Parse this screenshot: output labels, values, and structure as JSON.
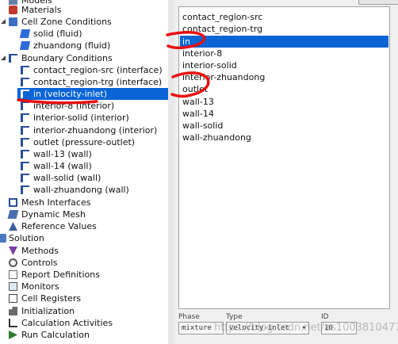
{
  "tree": {
    "items": [
      {
        "label": "Models",
        "icon": "models-icon"
      },
      {
        "label": "Materials",
        "icon": "materials-icon"
      },
      {
        "label": "Cell Zone Conditions",
        "icon": "cell-zone-icon"
      },
      {
        "label": "solid (fluid)",
        "icon": "zone-icon"
      },
      {
        "label": "zhuandong (fluid)",
        "icon": "zone-icon"
      },
      {
        "label": "Boundary Conditions",
        "icon": "boundary-icon"
      },
      {
        "label": "contact_region-src (interface)",
        "icon": "bc-icon"
      },
      {
        "label": "contact_region-trg (interface)",
        "icon": "bc-icon"
      },
      {
        "label": "in (velocity-inlet)",
        "icon": "bc-icon"
      },
      {
        "label": "interior-8 (interior)",
        "icon": "bc-icon"
      },
      {
        "label": "interior-solid (interior)",
        "icon": "bc-icon"
      },
      {
        "label": "interior-zhuandong (interior)",
        "icon": "bc-icon"
      },
      {
        "label": "outlet (pressure-outlet)",
        "icon": "bc-icon"
      },
      {
        "label": "wall-13 (wall)",
        "icon": "bc-icon"
      },
      {
        "label": "wall-14 (wall)",
        "icon": "bc-icon"
      },
      {
        "label": "wall-solid (wall)",
        "icon": "bc-icon"
      },
      {
        "label": "wall-zhuandong (wall)",
        "icon": "bc-icon"
      },
      {
        "label": "Mesh Interfaces",
        "icon": "mesh-interfaces-icon"
      },
      {
        "label": "Dynamic Mesh",
        "icon": "dynamic-mesh-icon"
      },
      {
        "label": "Reference Values",
        "icon": "reference-values-icon"
      },
      {
        "label": "Solution",
        "icon": "solution-icon"
      },
      {
        "label": "Methods",
        "icon": "methods-icon"
      },
      {
        "label": "Controls",
        "icon": "controls-icon"
      },
      {
        "label": "Report Definitions",
        "icon": "report-icon"
      },
      {
        "label": "Monitors",
        "icon": "monitors-icon"
      },
      {
        "label": "Cell Registers",
        "icon": "cell-registers-icon"
      },
      {
        "label": "Initialization",
        "icon": "initialization-icon"
      },
      {
        "label": "Calculation Activities",
        "icon": "calc-activities-icon"
      },
      {
        "label": "Run Calculation",
        "icon": "run-icon"
      }
    ]
  },
  "zones": {
    "items": [
      "contact_region-src",
      "contact_region-trg",
      "in",
      "interior-8",
      "interior-solid",
      "interior-zhuandong",
      "outlet",
      "wall-13",
      "wall-14",
      "wall-solid",
      "wall-zhuandong"
    ],
    "selected": "in"
  },
  "props": {
    "phase_label": "Phase",
    "phase_value": "mixture",
    "type_label": "Type",
    "type_value": "velocity-inlet",
    "id_label": "ID",
    "id_value": "10"
  },
  "watermark": "https://blog.csdn.net/as1003810477",
  "colors": {
    "selection": "#0a64d6",
    "annotation": "#e81010"
  }
}
